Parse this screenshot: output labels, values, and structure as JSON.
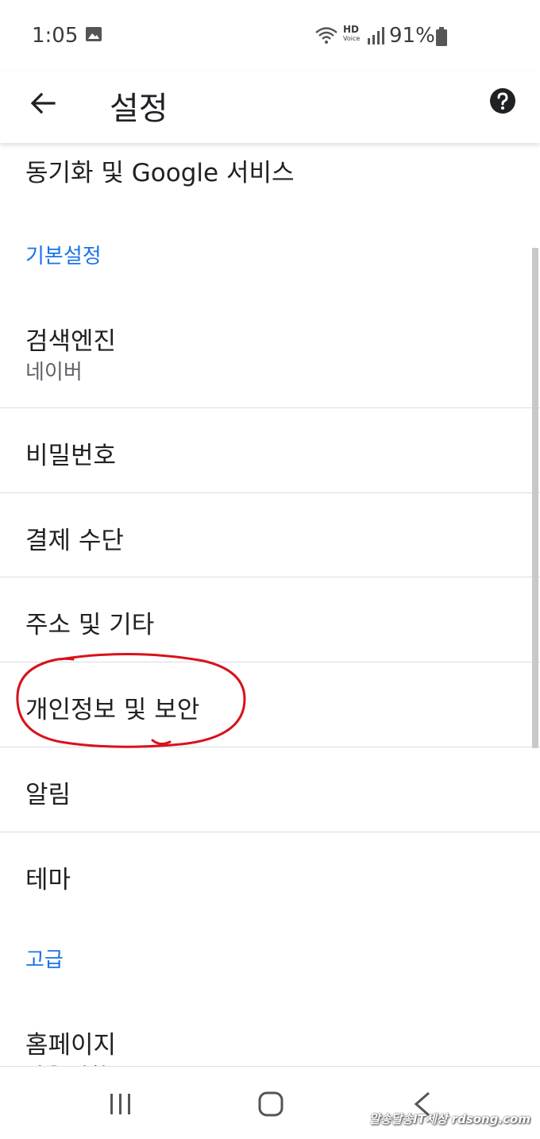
{
  "status_bar": {
    "time": "1:05",
    "battery": "91%",
    "hd_label": "HD",
    "voice_label": "Voice",
    "icons": [
      "photo-icon",
      "wifi-icon",
      "signal-icon",
      "battery-icon"
    ]
  },
  "app_bar": {
    "title": "설정",
    "back_icon": "back-arrow-icon",
    "help_icon": "help-icon"
  },
  "settings": {
    "sync": "동기화 및 Google 서비스",
    "section_basic": "기본설정",
    "search_engine": {
      "label": "검색엔진",
      "value": "네이버"
    },
    "passwords": "비밀번호",
    "payment": "결제 수단",
    "addresses": "주소 및 기타",
    "privacy": "개인정보 및 보안",
    "notifications": "알림",
    "theme": "테마",
    "section_advanced": "고급",
    "homepage": {
      "label": "홈페이지",
      "value": "사용 안함"
    }
  },
  "watermark": "알송달송IT세상 rdsong.com",
  "colors": {
    "accent": "#1a73e8",
    "annotation": "#d8121b",
    "divider": "#dadce0"
  }
}
